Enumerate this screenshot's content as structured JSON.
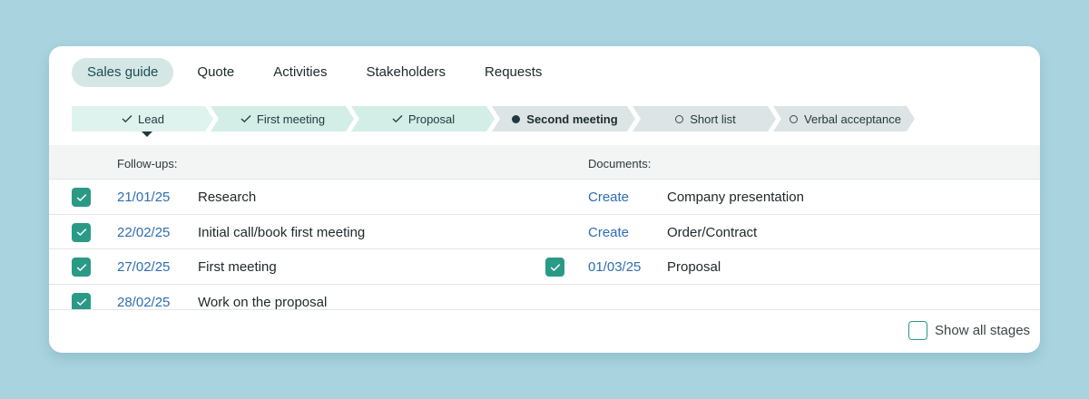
{
  "tabs": [
    {
      "label": "Sales guide",
      "active": true
    },
    {
      "label": "Quote",
      "active": false
    },
    {
      "label": "Activities",
      "active": false
    },
    {
      "label": "Stakeholders",
      "active": false
    },
    {
      "label": "Requests",
      "active": false
    }
  ],
  "stages": [
    {
      "label": "Lead",
      "status": "done",
      "icon": "check-icon"
    },
    {
      "label": "First meeting",
      "status": "done",
      "icon": "check-icon"
    },
    {
      "label": "Proposal",
      "status": "done",
      "icon": "check-icon"
    },
    {
      "label": "Second meeting",
      "status": "current",
      "icon": "filled-dot-icon"
    },
    {
      "label": "Short list",
      "status": "todo",
      "icon": "empty-circle-icon"
    },
    {
      "label": "Verbal acceptance",
      "status": "todo",
      "icon": "empty-circle-icon"
    }
  ],
  "followups": {
    "header": "Follow-ups:",
    "items": [
      {
        "checked": true,
        "date": "21/01/25",
        "text": "Research"
      },
      {
        "checked": true,
        "date": "22/02/25",
        "text": "Initial call/book first meeting"
      },
      {
        "checked": true,
        "date": "27/02/25",
        "text": "First meeting"
      },
      {
        "checked": true,
        "date": "28/02/25",
        "text": "Work on the proposal"
      }
    ]
  },
  "documents": {
    "header": "Documents:",
    "items": [
      {
        "checked": false,
        "action": "Create",
        "name": "Company presentation"
      },
      {
        "checked": false,
        "action": "Create",
        "name": "Order/Contract"
      },
      {
        "checked": true,
        "action": "01/03/25",
        "name": "Proposal"
      }
    ]
  },
  "show_all": {
    "label": "Show all stages",
    "checked": false
  },
  "colors": {
    "background": "#a9d4df",
    "accent": "#2a9a86",
    "link": "#2e6db3",
    "active_tab": "#d4e7e5",
    "stage_done": "#d2eee7",
    "stage_pending": "#dde4e5"
  }
}
